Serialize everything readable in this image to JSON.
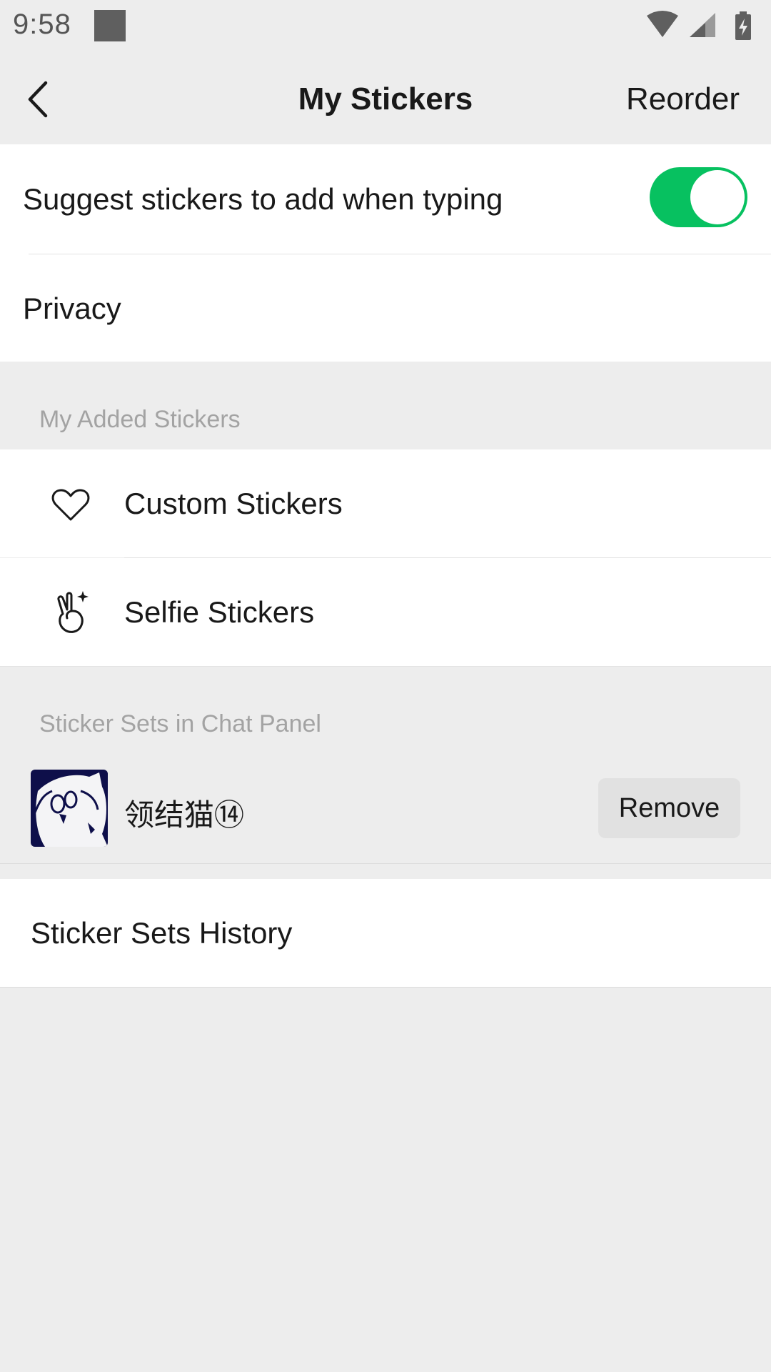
{
  "status_bar": {
    "time": "9:58"
  },
  "nav": {
    "title": "My Stickers",
    "action": "Reorder"
  },
  "settings": {
    "suggest_label": "Suggest stickers to add when typing",
    "suggest_enabled": true,
    "privacy_label": "Privacy"
  },
  "added_section": {
    "header": "My Added Stickers",
    "items": [
      {
        "label": "Custom Stickers",
        "icon": "heart-icon"
      },
      {
        "label": "Selfie Stickers",
        "icon": "peace-hand-icon"
      }
    ]
  },
  "chat_panel_section": {
    "header": "Sticker Sets in Chat Panel",
    "sets": [
      {
        "name": "领结猫⑭",
        "action": "Remove",
        "icon": "bowtie-cat-sticker-thumbnail"
      }
    ]
  },
  "history": {
    "label": "Sticker Sets History"
  },
  "colors": {
    "toggle_on": "#07c160",
    "background": "#ededed"
  }
}
